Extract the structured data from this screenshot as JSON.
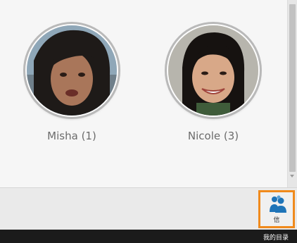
{
  "people": [
    {
      "name": "Misha (1)"
    },
    {
      "name": "Nicole (3)"
    }
  ],
  "toolbar": {
    "people_button_label": "信",
    "people_button_icon": "people-icon"
  },
  "taskbar": {
    "label": "我的目录"
  },
  "colors": {
    "accent_border": "#f08a1c",
    "icon_blue": "#1e74b8",
    "taskbar_bg": "#1b1b1b"
  }
}
